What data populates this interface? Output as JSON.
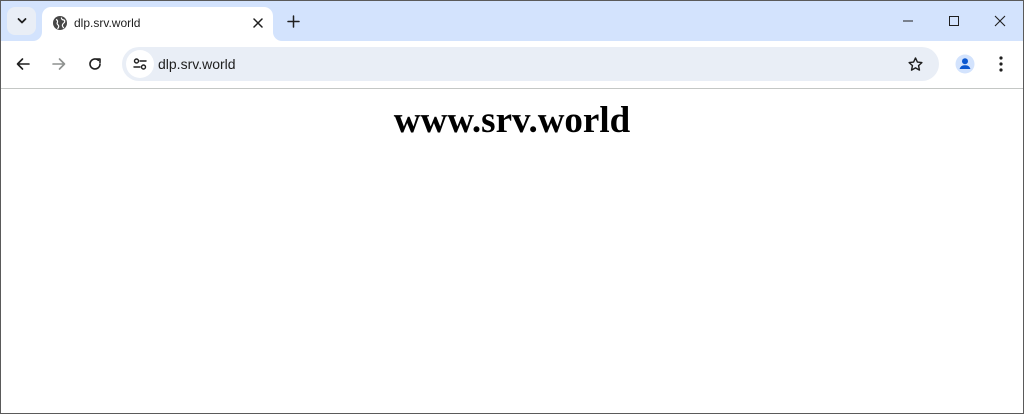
{
  "browser": {
    "tab": {
      "title": "dlp.srv.world",
      "favicon": "globe-icon"
    },
    "address_bar": {
      "value": "dlp.srv.world"
    },
    "icons": {
      "tab_search": "chevron-down-icon",
      "tab_close": "close-icon",
      "new_tab": "plus-icon",
      "minimize": "minimize-icon",
      "maximize": "maximize-icon",
      "window_close": "close-icon",
      "back": "arrow-left-icon",
      "forward": "arrow-right-icon",
      "reload": "reload-icon",
      "site_info": "tune-icon",
      "bookmark": "star-icon",
      "profile": "person-icon",
      "menu": "more-vert-icon"
    },
    "colors": {
      "tabstrip": "#d3e3fd",
      "omnibox": "#e9eef6",
      "profile_accent": "#0b57d0"
    }
  },
  "page": {
    "heading": "www.srv.world"
  }
}
